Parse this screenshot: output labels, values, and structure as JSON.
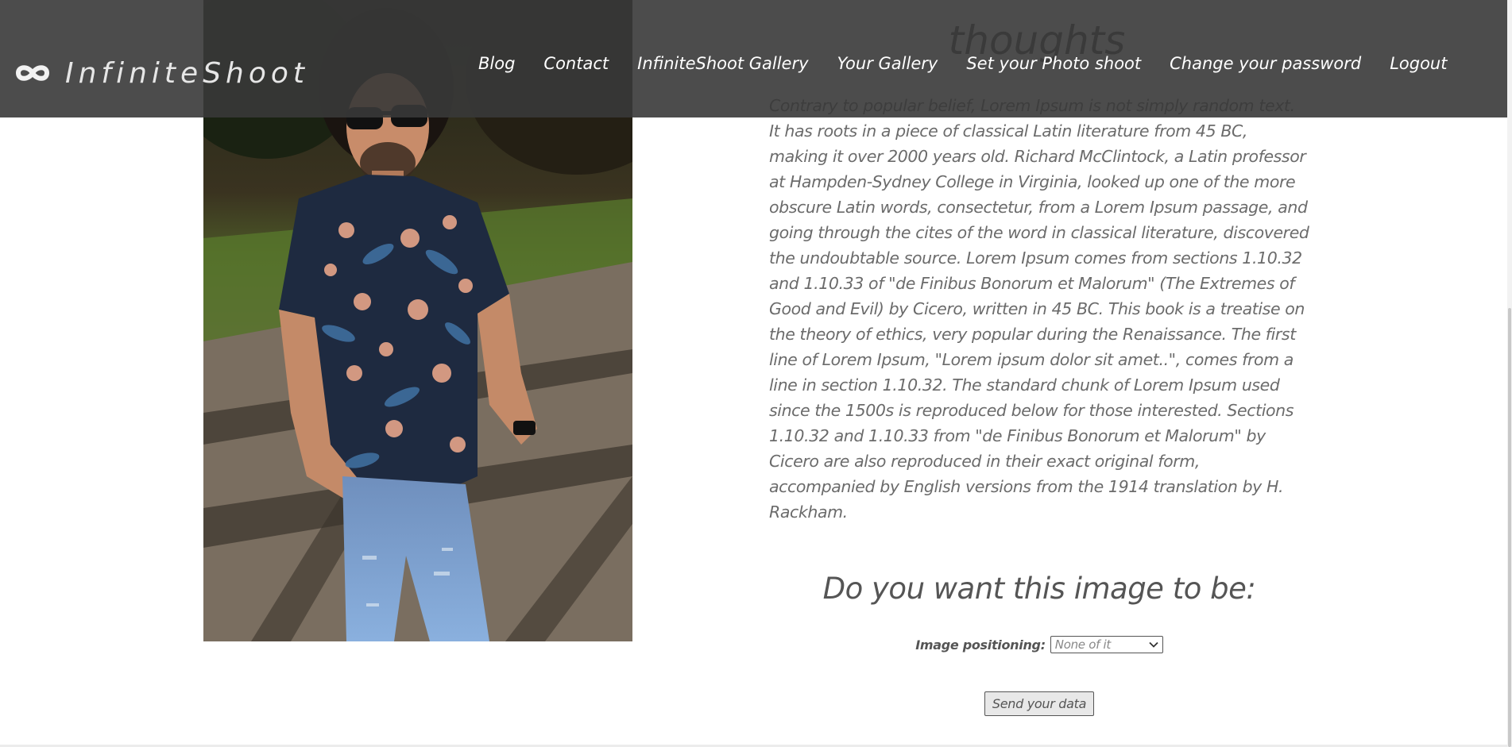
{
  "brand": {
    "name": "InfiniteShoot",
    "icon": "infinity-icon"
  },
  "nav": {
    "items": [
      {
        "label": "Blog"
      },
      {
        "label": "Contact"
      },
      {
        "label": "InfiniteShoot Gallery"
      },
      {
        "label": "Your Gallery"
      },
      {
        "label": "Set your Photo shoot"
      },
      {
        "label": "Change your password"
      },
      {
        "label": "Logout"
      }
    ]
  },
  "article": {
    "heading": "thoughts",
    "body": "Contrary to popular belief, Lorem Ipsum is not simply random text. It has roots in a piece of classical Latin literature from 45 BC, making it over 2000 years old. Richard McClintock, a Latin professor at Hampden-Sydney College in Virginia, looked up one of the more obscure Latin words, consectetur, from a Lorem Ipsum passage, and going through the cites of the word in classical literature, discovered the undoubtable source. Lorem Ipsum comes from sections 1.10.32 and 1.10.33 of \"de Finibus Bonorum et Malorum\" (The Extremes of Good and Evil) by Cicero, written in 45 BC. This book is a treatise on the theory of ethics, very popular during the Renaissance. The first line of Lorem Ipsum, \"Lorem ipsum dolor sit amet..\", comes from a line in section 1.10.32. The standard chunk of Lorem Ipsum used since the 1500s is reproduced below for those interested. Sections 1.10.32 and 1.10.33 from \"de Finibus Bonorum et Malorum\" by Cicero are also reproduced in their exact original form, accompanied by English versions from the 1914 translation by H. Rackham."
  },
  "form": {
    "question": "Do you want this image to be:",
    "positioning_label": "Image positioning:",
    "positioning_value": "None of it",
    "submit_label": "Send your data"
  },
  "colors": {
    "navbar_bg": "#383838",
    "text_gray": "#6b6b6b"
  }
}
